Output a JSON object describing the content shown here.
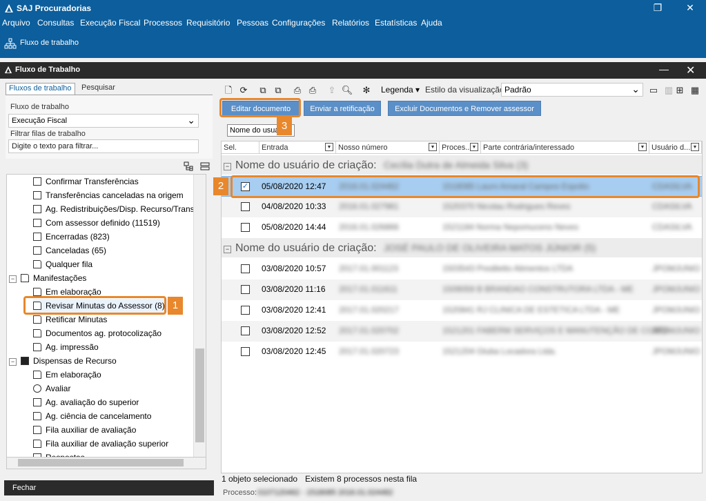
{
  "app": {
    "title": "SAJ Procuradorias",
    "window_controls": {
      "restore": "❐",
      "close": "✕"
    }
  },
  "menu": [
    "Arquivo",
    "Consultas",
    "Execução Fiscal",
    "Processos",
    "Requisitório",
    "Pessoas",
    "Configurações",
    "Relatórios",
    "Estatísticas",
    "Ajuda"
  ],
  "toolbar": {
    "workflow_label": "Fluxo de trabalho"
  },
  "subwindow": {
    "title": "Fluxo de Trabalho",
    "min": "—",
    "close": "✕"
  },
  "left": {
    "tabs": [
      "Fluxos de trabalho",
      "Pesquisar"
    ],
    "flow_label": "Fluxo de trabalho",
    "flow_value": "Execução Fiscal",
    "filter_label": "Filtrar filas de trabalho",
    "filter_placeholder": "Digite o texto para filtrar...",
    "tree": [
      {
        "label": "Confirmar Transferências",
        "level": 2
      },
      {
        "label": "Transferências canceladas na origem",
        "level": 2
      },
      {
        "label": "Ag. Redistribuições/Disp. Recurso/Transfer",
        "level": 2
      },
      {
        "label": "Com assessor definido (11519)",
        "level": 2
      },
      {
        "label": "Encerradas (823)",
        "level": 2
      },
      {
        "label": "Canceladas (65)",
        "level": 2
      },
      {
        "label": "Qualquer fila",
        "level": 2
      },
      {
        "label": "Manifestações",
        "level": 1,
        "expander": "−"
      },
      {
        "label": "Em elaboração",
        "level": 2
      },
      {
        "label": "Revisar Minutas do Assessor (8)",
        "level": 2
      },
      {
        "label": "Retificar Minutas",
        "level": 2
      },
      {
        "label": "Documentos ag. protocolização",
        "level": 2
      },
      {
        "label": "Ag. impressão",
        "level": 2
      },
      {
        "label": "Dispensas de Recurso",
        "level": 1,
        "expander": "−"
      },
      {
        "label": "Em elaboração",
        "level": 2
      },
      {
        "label": "Avaliar",
        "level": 2
      },
      {
        "label": "Ag. avaliação do superior",
        "level": 2
      },
      {
        "label": "Ag. ciência de cancelamento",
        "level": 2
      },
      {
        "label": "Fila auxiliar de avaliação",
        "level": 2
      },
      {
        "label": "Fila auxiliar de avaliação superior",
        "level": 2
      },
      {
        "label": "Respostas",
        "level": 2
      }
    ],
    "close_label": "Fechar"
  },
  "right": {
    "legend_label": "Legenda",
    "view_style_label": "Estilo da visualização",
    "view_style_value": "Padrão",
    "buttons": {
      "edit": "Editar documento",
      "send": "Enviar a retificação",
      "delete": "Excluir Documentos e Remover assessor"
    },
    "group_chip": "Nome do usuá",
    "columns": [
      "Sel.",
      "Entrada",
      "Nosso número",
      "Proces...",
      "Parte contrária/interessado",
      "Usuário d..."
    ],
    "groups": [
      {
        "label": "Nome do usuário de criação:",
        "name": "Cecília Dutra de Almeida Silva (3)",
        "rows": [
          {
            "date": "05/08/2020 12:47",
            "nosso": "2016.01.024482",
            "proc": "1518085 Lauro Amaral Campos Espolio",
            "user": "CDASILVA",
            "checked": true
          },
          {
            "date": "04/08/2020 10:33",
            "nosso": "2016.01.027981",
            "proc": "1520370 Nicolau Rodrigues Reves",
            "user": "CDASILVA",
            "checked": false
          },
          {
            "date": "05/08/2020 14:44",
            "nosso": "2016.01.026866",
            "proc": "1521184 Norma Nepomuceno Neves",
            "user": "CDASILVA",
            "checked": false
          }
        ]
      },
      {
        "label": "Nome do usuário de criação:",
        "name": "JOSÉ PAULO DE OLIVEIRA MATOS JÚNIOR (5)",
        "rows": [
          {
            "date": "03/08/2020 10:57",
            "nosso": "2017.01.001123",
            "proc": "1503543 Prediletto Alimentos LTDA",
            "user": "JPOMJUNIO",
            "checked": false
          },
          {
            "date": "03/08/2020 11:16",
            "nosso": "2017.01.011611",
            "proc": "1509059 B BRANDAO CONSTRUTORA LTDA - ME",
            "user": "JPOMJUNIO",
            "checked": false
          },
          {
            "date": "03/08/2020 12:41",
            "nosso": "2017.01.020217",
            "proc": "1520841 RJ CLINICA DE ESTETICA LTDA - ME",
            "user": "JPOMJUNIO",
            "checked": false
          },
          {
            "date": "03/08/2020 12:52",
            "nosso": "2017.01.020702",
            "proc": "1521201 FABERM SERVIÇOS E MANUTENÇÃO DE CONDI",
            "user": "JPOMJUNIO",
            "checked": false
          },
          {
            "date": "03/08/2020 12:45",
            "nosso": "2017.01.020723",
            "proc": "1521204 Gluba Locadora Ltda.",
            "user": "JPOMJUNIO",
            "checked": false
          }
        ]
      }
    ],
    "status": {
      "selected": "1 objeto selecionado",
      "count": "Existem 8 processos nesta fila",
      "process_label": "Processo:",
      "process_value": "0107120462 - 1518085 2016.01.024482"
    }
  },
  "callouts": [
    "1",
    "2",
    "3"
  ],
  "colors": {
    "accent": "#0c5e9c",
    "callout": "#e8872b",
    "selection": "#a7cdf0",
    "button": "#5b8fc7"
  }
}
